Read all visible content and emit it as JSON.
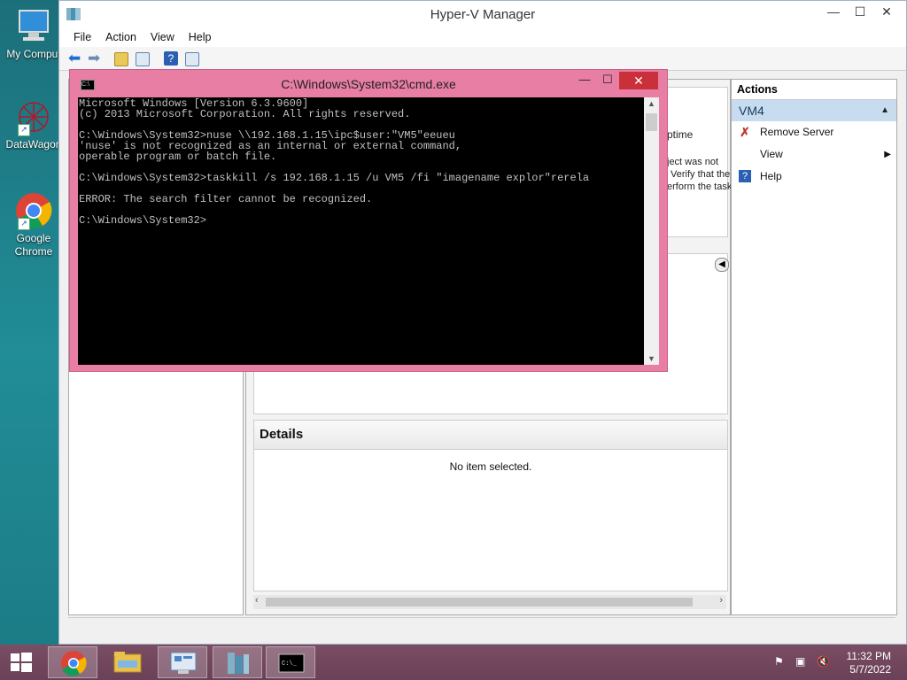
{
  "desktop": {
    "icons": [
      {
        "label": "My Comput",
        "icon": "computer-icon"
      },
      {
        "label": "DataWagon",
        "icon": "datawagon-icon"
      },
      {
        "label": "Google\nChrome",
        "icon": "chrome-icon"
      }
    ]
  },
  "hyperv": {
    "title": "Hyper-V Manager",
    "menu": [
      "File",
      "Action",
      "View",
      "Help"
    ],
    "center_fragments": {
      "col_uptime": "ptime",
      "msg1": "ject was not",
      "msg2": "Verify that the",
      "msg3": "erform the task"
    },
    "details": {
      "title": "Details",
      "message": "No item selected."
    },
    "actions": {
      "header": "Actions",
      "group": "VM4",
      "items": [
        {
          "label": "Remove Server",
          "icon": "remove-x-icon"
        },
        {
          "label": "View",
          "icon": "none"
        },
        {
          "label": "Help",
          "icon": "help-icon"
        }
      ]
    }
  },
  "cmd": {
    "title": "C:\\Windows\\System32\\cmd.exe",
    "lines": [
      "Microsoft Windows [Version 6.3.9600]",
      "(c) 2013 Microsoft Corporation. All rights reserved.",
      "",
      "C:\\Windows\\System32>nuse \\\\192.168.1.15\\ipc$user:\"VM5\"eeueu",
      "'nuse' is not recognized as an internal or external command,",
      "operable program or batch file.",
      "",
      "C:\\Windows\\System32>taskkill /s 192.168.1.15 /u VM5 /fi \"imagename explor\"rerela",
      "",
      "ERROR: The search filter cannot be recognized.",
      "",
      "C:\\Windows\\System32>"
    ]
  },
  "taskbar": {
    "apps": [
      "start-button",
      "chrome-icon",
      "file-explorer-icon",
      "server-manager-icon",
      "hyperv-manager-icon",
      "cmd-icon"
    ],
    "time": "11:32 PM",
    "date": "5/7/2022"
  },
  "colors": {
    "cmd_frame": "#e87ea3",
    "desktop": "#1f7f88",
    "taskbar": "#6a4158"
  }
}
